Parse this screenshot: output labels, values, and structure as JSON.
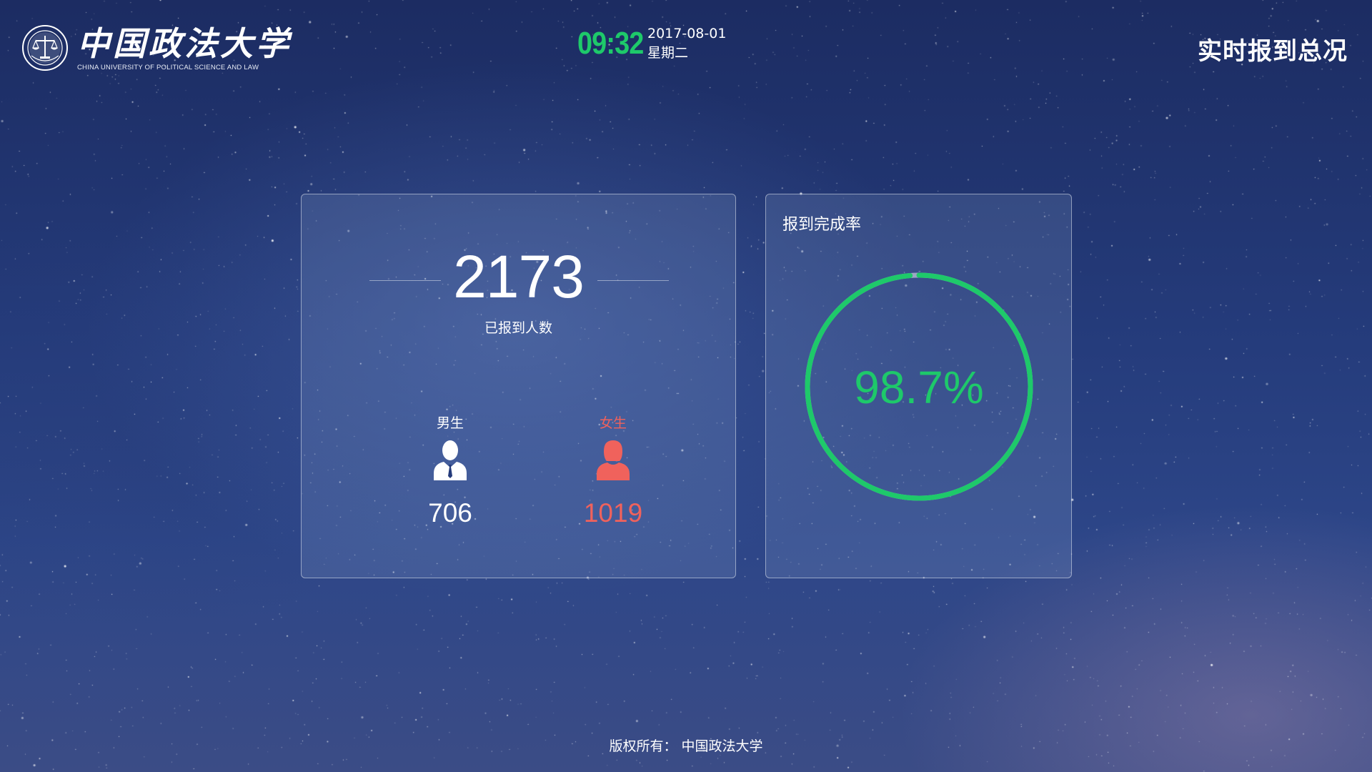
{
  "header": {
    "logo": {
      "name_cn": "中国政法大学",
      "name_en": "CHINA UNIVERSITY OF POLITICAL SCIENCE AND LAW"
    },
    "clock": {
      "time": "09:32",
      "date": "2017-08-01",
      "weekday": "星期二"
    },
    "title": "实时报到总况"
  },
  "summary": {
    "total": "2173",
    "total_label": "已报到人数",
    "male": {
      "label": "男生",
      "count": "706",
      "icon": "male-person-icon",
      "color": "#ffffff"
    },
    "female": {
      "label": "女生",
      "count": "1019",
      "icon": "female-person-icon",
      "color": "#f0625c"
    }
  },
  "completion": {
    "title": "报到完成率",
    "rate_text": "98.7%",
    "rate": 0.987,
    "color": "#1ec96a",
    "track_color": "#9aa6c4"
  },
  "footer": {
    "copyright": "版权所有：  中国政法大学"
  },
  "colors": {
    "accent_green": "#1ec96a",
    "female_red": "#f0625c"
  }
}
